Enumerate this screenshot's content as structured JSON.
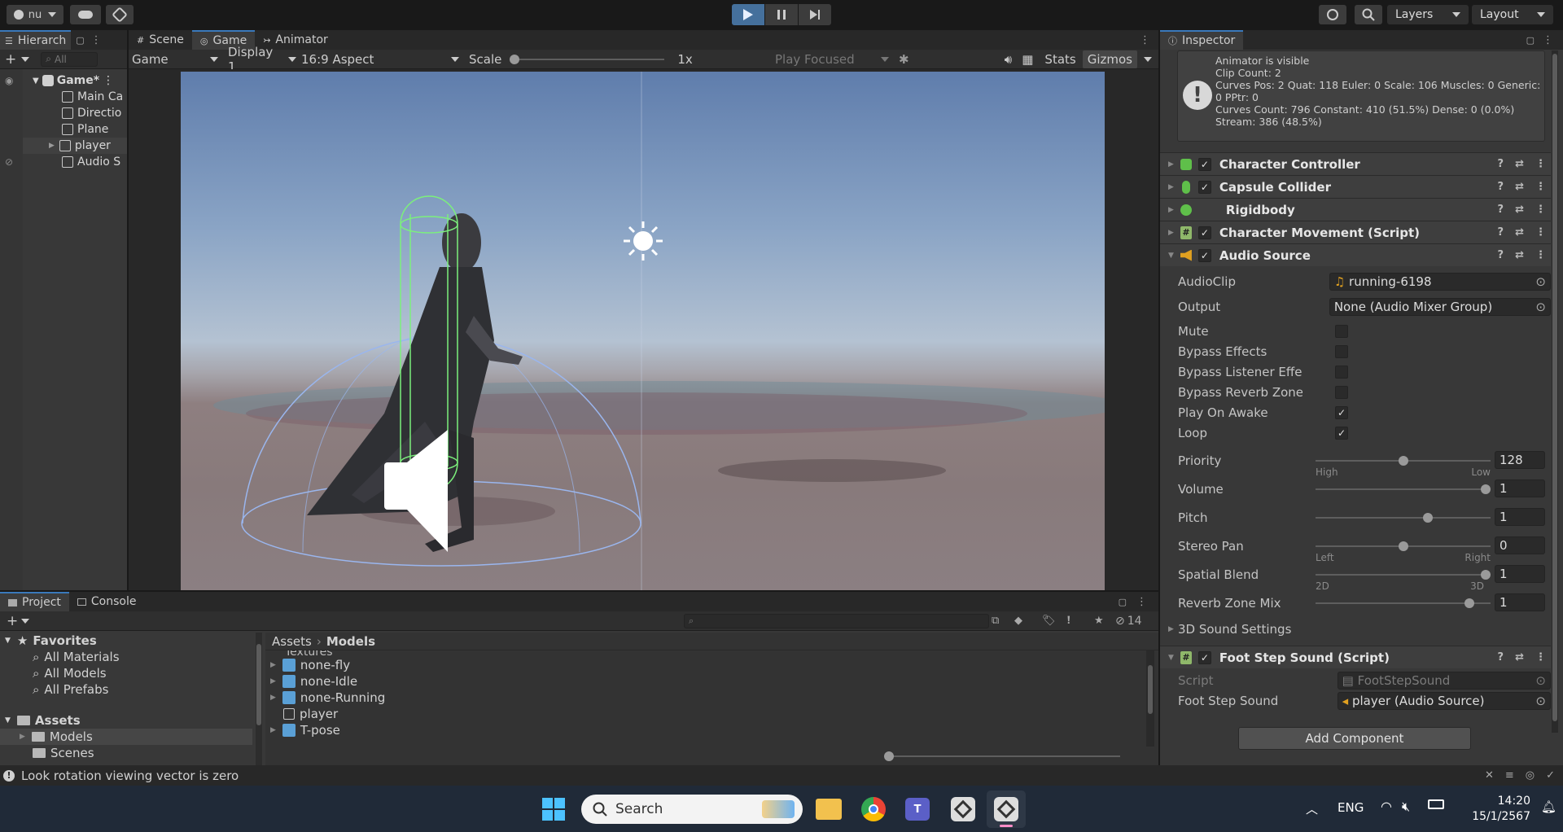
{
  "toolbar": {
    "account_label": "nu",
    "layers_label": "Layers",
    "layout_label": "Layout"
  },
  "hierarchy": {
    "tab_label": "Hierarch",
    "search_placeholder": "All",
    "scene_name": "Game*",
    "items": [
      "Main Ca",
      "Directio",
      "Plane",
      "player",
      "Audio S"
    ]
  },
  "game_view": {
    "tabs": [
      "Scene",
      "Game",
      "Animator"
    ],
    "display_mode": "Game",
    "display": "Display 1",
    "aspect": "16:9 Aspect",
    "scale_label": "Scale",
    "scale_value": "1x",
    "play_focused": "Play Focused",
    "stats": "Stats",
    "gizmos": "Gizmos"
  },
  "inspector": {
    "tab_label": "Inspector",
    "info_lines": [
      "Animator is visible",
      "Clip Count: 2",
      "Curves Pos: 2 Quat: 118 Euler: 0 Scale: 106 Muscles: 0 Generic:",
      "0 PPtr: 0",
      "Curves Count: 796 Constant: 410 (51.5%) Dense: 0 (0.0%)",
      "Stream: 386 (48.5%)"
    ],
    "components": [
      {
        "name": "Character Controller",
        "checked": true,
        "icon_color": "#5fbf4a"
      },
      {
        "name": "Capsule Collider",
        "checked": true,
        "icon_color": "#5fbf4a"
      },
      {
        "name": "Rigidbody",
        "checked": false,
        "icon_color": "#5fbf4a"
      },
      {
        "name": "Character Movement (Script)",
        "checked": true,
        "icon_color": "#8fb86a"
      }
    ],
    "audio_source": {
      "title": "Audio Source",
      "audio_clip_label": "AudioClip",
      "audio_clip_value": "running-6198",
      "output_label": "Output",
      "output_value": "None (Audio Mixer Group)",
      "toggles": [
        {
          "label": "Mute",
          "checked": false
        },
        {
          "label": "Bypass Effects",
          "checked": false
        },
        {
          "label": "Bypass Listener Effects",
          "checked": false
        },
        {
          "label": "Bypass Reverb Zones",
          "checked": false
        },
        {
          "label": "Play On Awake",
          "checked": true
        },
        {
          "label": "Loop",
          "checked": true
        }
      ],
      "sliders": [
        {
          "label": "Priority",
          "value": "128",
          "fraction": 0.5,
          "min_label": "High",
          "max_label": "Low"
        },
        {
          "label": "Volume",
          "value": "1",
          "fraction": 1.0
        },
        {
          "label": "Pitch",
          "value": "1",
          "fraction": 0.65
        },
        {
          "label": "Stereo Pan",
          "value": "0",
          "fraction": 0.5,
          "min_label": "Left",
          "max_label": "Right"
        },
        {
          "label": "Spatial Blend",
          "value": "1",
          "fraction": 1.0,
          "min_label": "2D",
          "max_label": "3D"
        },
        {
          "label": "Reverb Zone Mix",
          "value": "1",
          "fraction": 0.9
        }
      ],
      "sound_settings": "3D Sound Settings"
    },
    "footstep": {
      "title": "Foot Step Sound (Script)",
      "script_label": "Script",
      "script_value": "FootStepSound",
      "sound_label": "Foot Step Sound",
      "sound_value": "player (Audio Source)"
    },
    "add_component": "Add Component"
  },
  "project": {
    "tabs": [
      "Project",
      "Console"
    ],
    "favorites_label": "Favorites",
    "favorites": [
      "All Materials",
      "All Models",
      "All Prefabs"
    ],
    "assets_label": "Assets",
    "asset_folders": [
      "Models",
      "Scenes"
    ],
    "breadcrumb_root": "Assets",
    "breadcrumb_current": "Models",
    "partial_item": "Textures",
    "items": [
      "none-fly",
      "none-Idle",
      "none-Running",
      "player",
      "T-pose"
    ],
    "hidden_count": "14"
  },
  "status": {
    "message": "Look rotation viewing vector is zero"
  },
  "taskbar": {
    "search_label": "Search",
    "language": "ENG",
    "time": "14:20",
    "date": "15/1/2567"
  },
  "colors": {
    "accent": "#3a79bb",
    "panel": "#383838",
    "toolbar": "#191919",
    "gizmo_green": "#7cf07c",
    "gizmo_blue": "#8fb0f0"
  }
}
